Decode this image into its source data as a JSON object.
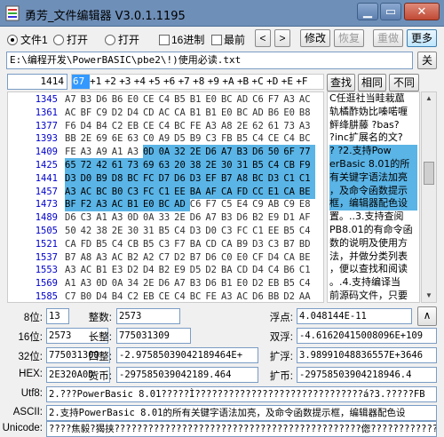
{
  "window": {
    "title": "勇芳_文件编辑器 V3.0.1.1195",
    "controls": {
      "minimize": "▁",
      "maximize": "▭",
      "close": "✕"
    }
  },
  "toolbar": {
    "radio_file1": "文件1",
    "radio_open1": "打开",
    "radio_open2": "打开",
    "check_hex": "16进制",
    "check_top": "最前",
    "nav_prev": "<",
    "nav_next": ">",
    "modify": "修改",
    "restore": "恢复",
    "redo": "重做",
    "more": "更多"
  },
  "path": {
    "value": "E:\\编程开发\\PowerBASIC\\pbe2\\!)使用必读.txt",
    "close_label": "关"
  },
  "search": {
    "offset": "1414",
    "find": "查找",
    "same": "相同",
    "diff": "不同"
  },
  "hex": {
    "columns": [
      "67",
      "+1",
      "+2",
      "+3",
      "+4",
      "+5",
      "+6",
      "+7",
      "+8",
      "+9",
      "+A",
      "+B",
      "+C",
      "+D",
      "+E",
      "+F"
    ],
    "rows": [
      {
        "addr": "1345",
        "bytes": [
          "A7",
          "B3",
          "D6",
          "B6",
          "E0",
          "CE",
          "C4",
          "B5",
          "B1",
          "E0",
          "BC",
          "AD",
          "C6",
          "F7",
          "A3",
          "AC"
        ]
      },
      {
        "addr": "1361",
        "bytes": [
          "AC",
          "BF",
          "C9",
          "D2",
          "D4",
          "CD",
          "AC",
          "CA",
          "B1",
          "B1",
          "E0",
          "BC",
          "AD",
          "B6",
          "E0",
          "B8"
        ]
      },
      {
        "addr": "1377",
        "bytes": [
          "F6",
          "D4",
          "B4",
          "C2",
          "EB",
          "CE",
          "C4",
          "BC",
          "FE",
          "A3",
          "A8",
          "2E",
          "62",
          "61",
          "73",
          "A3"
        ]
      },
      {
        "addr": "1393",
        "bytes": [
          "BB",
          "2E",
          "69",
          "6E",
          "63",
          "C0",
          "A9",
          "D5",
          "B9",
          "C3",
          "FB",
          "B5",
          "C4",
          "CE",
          "C4",
          "BC"
        ]
      },
      {
        "addr": "1409",
        "bytes": [
          "FE",
          "A3",
          "A9",
          "A1",
          "A3",
          "0D",
          "0A",
          "32",
          "2E",
          "D6",
          "A7",
          "B3",
          "D6",
          "50",
          "6F",
          "77"
        ]
      },
      {
        "addr": "1425",
        "bytes": [
          "65",
          "72",
          "42",
          "61",
          "73",
          "69",
          "63",
          "20",
          "38",
          "2E",
          "30",
          "31",
          "B5",
          "C4",
          "CB",
          "F9"
        ]
      },
      {
        "addr": "1441",
        "bytes": [
          "D3",
          "D0",
          "B9",
          "D8",
          "BC",
          "FC",
          "D7",
          "D6",
          "D3",
          "EF",
          "B7",
          "A8",
          "BC",
          "D3",
          "C1",
          "C1"
        ]
      },
      {
        "addr": "1457",
        "bytes": [
          "A3",
          "AC",
          "BC",
          "B0",
          "C3",
          "FC",
          "C1",
          "EE",
          "BA",
          "AF",
          "CA",
          "FD",
          "CC",
          "E1",
          "CA",
          "BE"
        ]
      },
      {
        "addr": "1473",
        "bytes": [
          "BF",
          "F2",
          "A3",
          "AC",
          "B1",
          "E0",
          "BC",
          "AD",
          "C6",
          "F7",
          "C5",
          "E4",
          "C9",
          "AB",
          "C9",
          "E8"
        ]
      },
      {
        "addr": "1489",
        "bytes": [
          "D6",
          "C3",
          "A1",
          "A3",
          "0D",
          "0A",
          "33",
          "2E",
          "D6",
          "A7",
          "B3",
          "D6",
          "B2",
          "E9",
          "D1",
          "AF"
        ]
      },
      {
        "addr": "1505",
        "bytes": [
          "50",
          "42",
          "38",
          "2E",
          "30",
          "31",
          "B5",
          "C4",
          "D3",
          "D0",
          "C3",
          "FC",
          "C1",
          "EE",
          "B5",
          "C4"
        ]
      },
      {
        "addr": "1521",
        "bytes": [
          "CA",
          "FD",
          "B5",
          "C4",
          "CB",
          "B5",
          "C3",
          "F7",
          "BA",
          "CD",
          "CA",
          "B9",
          "D3",
          "C3",
          "B7",
          "BD"
        ]
      },
      {
        "addr": "1537",
        "bytes": [
          "B7",
          "A8",
          "A3",
          "AC",
          "B2",
          "A2",
          "C7",
          "D2",
          "B7",
          "D6",
          "C0",
          "E0",
          "CF",
          "D4",
          "CA",
          "BE"
        ]
      },
      {
        "addr": "1553",
        "bytes": [
          "A3",
          "AC",
          "B1",
          "E3",
          "D2",
          "D4",
          "B2",
          "E9",
          "D5",
          "D2",
          "BA",
          "CD",
          "D4",
          "C4",
          "B6",
          "C1"
        ]
      },
      {
        "addr": "1569",
        "bytes": [
          "A1",
          "A3",
          "0D",
          "0A",
          "34",
          "2E",
          "D6",
          "A7",
          "B3",
          "D6",
          "B1",
          "E0",
          "D2",
          "EB",
          "B5",
          "C4"
        ]
      },
      {
        "addr": "1585",
        "bytes": [
          "C7",
          "B0",
          "D4",
          "B4",
          "C2",
          "EB",
          "CE",
          "C4",
          "BC",
          "FE",
          "A3",
          "AC",
          "D6",
          "BB",
          "D2",
          "AA"
        ]
      }
    ]
  },
  "text_pane": {
    "lines": [
      "C任逛社当畦栽蓏",
      "轨橘酢妫比嗪喏喱",
      "鲆绛肼藤  ?bas?",
      "?inc扩展名的文?",
      "?   ?2.支持Pow",
      "erBasic 8.01的所",
      "有关键字语法加亮",
      "，及命令函数提示",
      "框，编辑器配色设",
      "置。..3.支持查阅",
      "PB8.01的有命令函",
      "数的说明及使用方",
      "法，并做分类列表",
      "，便以查找和阅读",
      "。.4.支持编译当",
      "前源码文件，只要"
    ]
  },
  "values": {
    "b8_label": "8位:",
    "b8": "13",
    "int_label": "整数:",
    "int": "2573",
    "float_label": "浮点:",
    "float": "4.048144E-11",
    "b16_label": "16位:",
    "b16": "2573",
    "long_label": "长整:",
    "long": "775031309",
    "double_label": "双浮:",
    "double": "-4.61620415008096E+109",
    "b32_label": "32位:",
    "b32": "775031309",
    "quad_label": "四整:",
    "quad": "-2.97585039042189464E+",
    "ext_label": "扩浮:",
    "ext": "3.9899104883655​7E+3646",
    "hex_label": "HEX:",
    "hex": "2E320A0D",
    "cur_label": "货币:",
    "cur": "-297585039042189.464",
    "extcur_label": "扩币:",
    "extcur": "-297585039042189​46.4",
    "utf8_label": "Utf8:",
    "utf8": "2.???PowerBasic 8.01?????Ì??????????????????????????????á?3.?????FB",
    "ascii_label": "ASCII:",
    "ascii": "2.支持PowerBasic 8.01的所有关键字语法加亮，及命令函数提示框，编辑器配色设",
    "unicode_label": "Unicode:",
    "unicode": "????焦毅?猲挟????????????????????????????????????????????偬?????????????????"
  },
  "colors": {
    "title_bar": "#6e8fb8",
    "highlight": "#5ab4e6",
    "address": "#0000cc"
  }
}
